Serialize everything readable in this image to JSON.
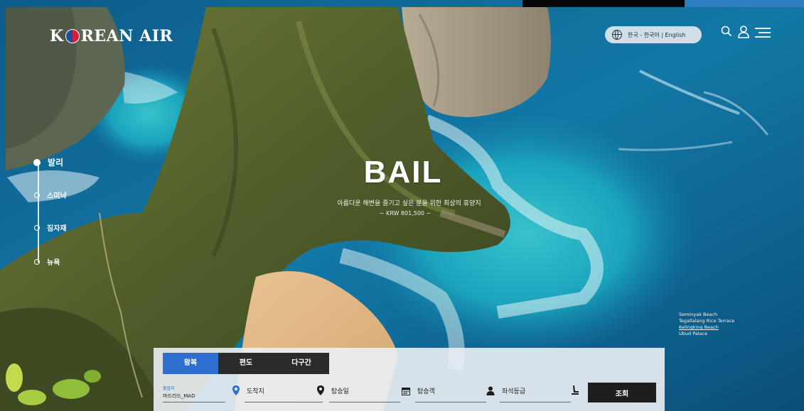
{
  "header": {
    "logo_text": "KOREAN AIR",
    "language_selector": "한국 - 한국어 | English"
  },
  "side_nav": {
    "items": [
      {
        "label": "발리",
        "active": true
      },
      {
        "label": "스미냑",
        "active": false
      },
      {
        "label": "짐자재",
        "active": false
      },
      {
        "label": "뉴욕",
        "active": false
      }
    ]
  },
  "hero": {
    "title": "BAIL",
    "subtitle": "아름다운 해변을 즐기고 싶은 분을 위한 최상의 휴양지",
    "price": "~ KRW 801,500 ~"
  },
  "attractions": {
    "items": [
      "Seminyak Beach",
      "Tegallalang Rice Terrace",
      "Kelingking Beach",
      "Ubud Palace"
    ],
    "current_index": 2
  },
  "booking": {
    "tabs": [
      {
        "label": "왕복",
        "active": true
      },
      {
        "label": "편도",
        "active": false
      },
      {
        "label": "다구간",
        "active": false
      }
    ],
    "departure_caption": "출발지",
    "departure_value": "마드리드_MAD",
    "arrival_label": "도착지",
    "date_label": "탑승일",
    "passengers_label": "탑승객",
    "cabin_label": "좌석등급",
    "search_label": "조회"
  },
  "colors": {
    "accent_blue": "#2f6fcf",
    "dark_button": "#1e1e1e",
    "sea": "#0e5a86"
  },
  "icons": [
    "globe-icon",
    "search-icon",
    "user-icon",
    "menu-icon",
    "location-pin-icon",
    "calendar-icon",
    "person-icon",
    "seat-icon"
  ]
}
